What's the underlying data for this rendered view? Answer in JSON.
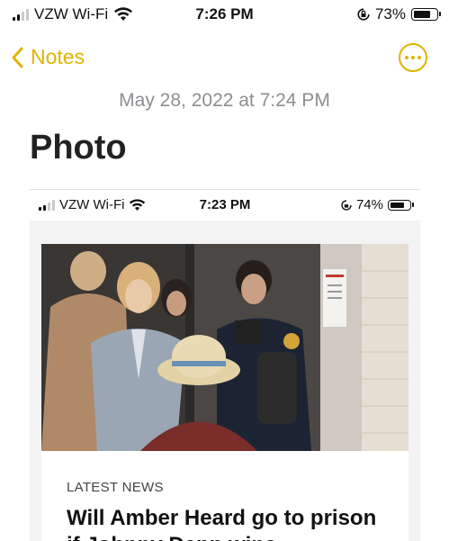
{
  "status_bar": {
    "carrier": "VZW Wi-Fi",
    "time": "7:26 PM",
    "battery": "73%",
    "battery_level": 0.73
  },
  "nav": {
    "back_label": "Notes",
    "accent_color": "#e0b400"
  },
  "note": {
    "date": "May 28, 2022 at 7:24 PM",
    "title": "Photo"
  },
  "photo": {
    "status_bar": {
      "carrier": "VZW Wi-Fi",
      "time": "7:23 PM",
      "battery": "74%",
      "battery_level": 0.74
    },
    "article": {
      "kicker": "LATEST NEWS",
      "headline": "Will Amber Heard go to prison if Johnny Depp wins"
    }
  }
}
